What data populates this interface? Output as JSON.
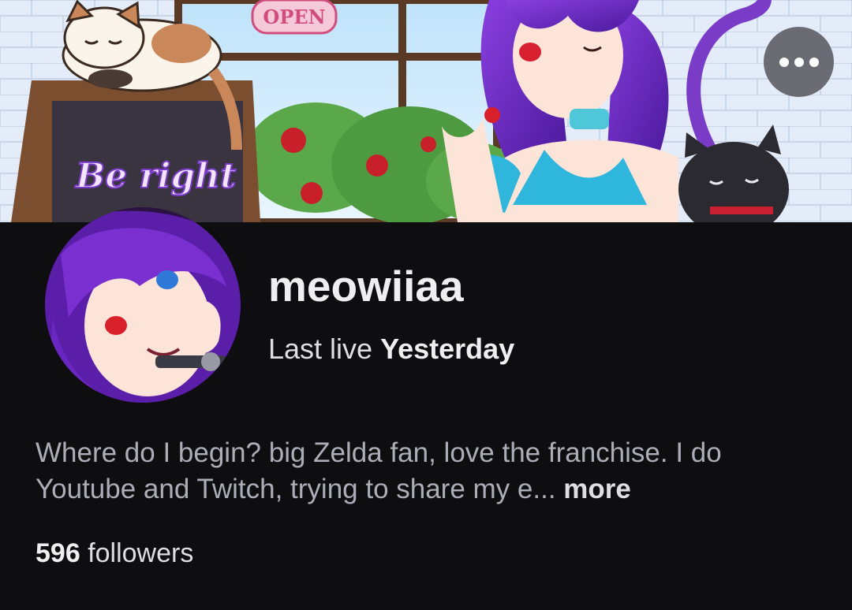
{
  "banner": {
    "sign_text": "Be right",
    "open_sign_text": "OPEN"
  },
  "menu": {
    "icon": "more-horizontal-icon"
  },
  "channel": {
    "username": "meowiiaa",
    "last_live_label": "Last live",
    "last_live_value": "Yesterday",
    "bio": "Where do I begin? big Zelda fan, love the franchise. I do Youtube and Twitch, trying to share my e...",
    "bio_more": "more",
    "followers_count": "596",
    "followers_label": "followers"
  },
  "colors": {
    "background": "#0e0e10",
    "text_primary": "#efeff1",
    "text_secondary": "#adadb8",
    "accent_purple": "#6a2bb8"
  }
}
